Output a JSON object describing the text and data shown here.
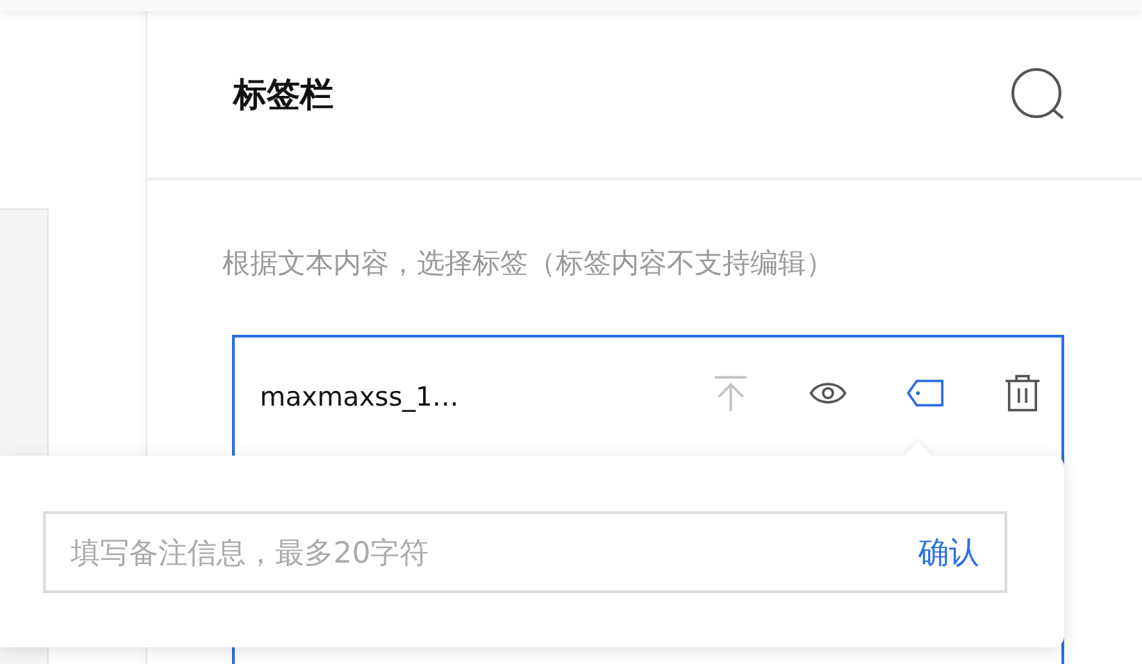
{
  "panel": {
    "title": "标签栏",
    "hint": "根据文本内容，选择标签（标签内容不支持编辑）"
  },
  "item": {
    "name": "maxmaxss_1…",
    "selected": true,
    "actions": [
      {
        "kind": "pin",
        "disabled": true,
        "selected": false
      },
      {
        "kind": "view",
        "disabled": false,
        "selected": false
      },
      {
        "kind": "tag",
        "disabled": false,
        "selected": true
      },
      {
        "kind": "delete",
        "disabled": false,
        "selected": false
      }
    ]
  },
  "note_popover": {
    "placeholder": "填写备注信息，最多20字符",
    "confirm": "确认"
  }
}
